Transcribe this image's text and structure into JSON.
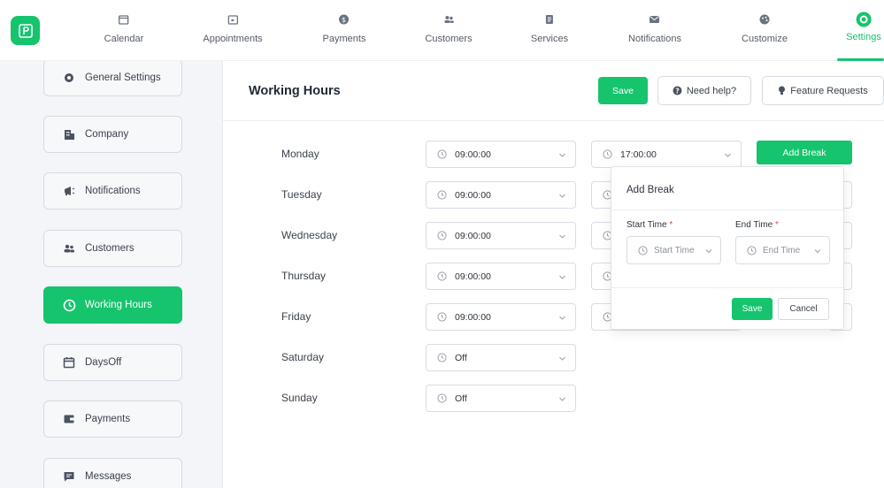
{
  "nav": {
    "items": [
      {
        "label": "Calendar",
        "icon": "calendar-icon"
      },
      {
        "label": "Appointments",
        "icon": "appointments-icon"
      },
      {
        "label": "Payments",
        "icon": "dollar-icon"
      },
      {
        "label": "Customers",
        "icon": "users-icon"
      },
      {
        "label": "Services",
        "icon": "services-icon"
      },
      {
        "label": "Notifications",
        "icon": "mail-icon"
      },
      {
        "label": "Customize",
        "icon": "palette-icon"
      },
      {
        "label": "Settings",
        "icon": "gear-icon"
      }
    ],
    "active": "Settings"
  },
  "sidebar": {
    "items": [
      {
        "label": "General Settings",
        "icon": "gear-icon"
      },
      {
        "label": "Company",
        "icon": "building-icon"
      },
      {
        "label": "Notifications",
        "icon": "megaphone-icon"
      },
      {
        "label": "Customers",
        "icon": "users-icon"
      },
      {
        "label": "Working Hours",
        "icon": "clock-icon"
      },
      {
        "label": "DaysOff",
        "icon": "calendar-icon"
      },
      {
        "label": "Payments",
        "icon": "wallet-icon"
      },
      {
        "label": "Messages",
        "icon": "chat-icon"
      }
    ],
    "active": "Working Hours"
  },
  "header": {
    "title": "Working Hours",
    "save_label": "Save",
    "help_label": "Need help?",
    "feature_label": "Feature Requests"
  },
  "days": [
    {
      "name": "Monday",
      "start": "09:00:00",
      "end": "17:00:00"
    },
    {
      "name": "Tuesday",
      "start": "09:00:00",
      "end": ""
    },
    {
      "name": "Wednesday",
      "start": "09:00:00",
      "end": ""
    },
    {
      "name": "Thursday",
      "start": "09:00:00",
      "end": ""
    },
    {
      "name": "Friday",
      "start": "09:00:00",
      "end": ""
    },
    {
      "name": "Saturday",
      "start": "Off",
      "end": ""
    },
    {
      "name": "Sunday",
      "start": "Off",
      "end": ""
    }
  ],
  "add_break": {
    "button_label": "Add Break",
    "popover_title": "Add Break",
    "start_label": "Start Time",
    "end_label": "End Time",
    "required_mark": "*",
    "start_placeholder": "Start Time",
    "end_placeholder": "End Time",
    "save_label": "Save",
    "cancel_label": "Cancel"
  },
  "colors": {
    "accent": "#16c46e",
    "required": "#ef4444"
  }
}
